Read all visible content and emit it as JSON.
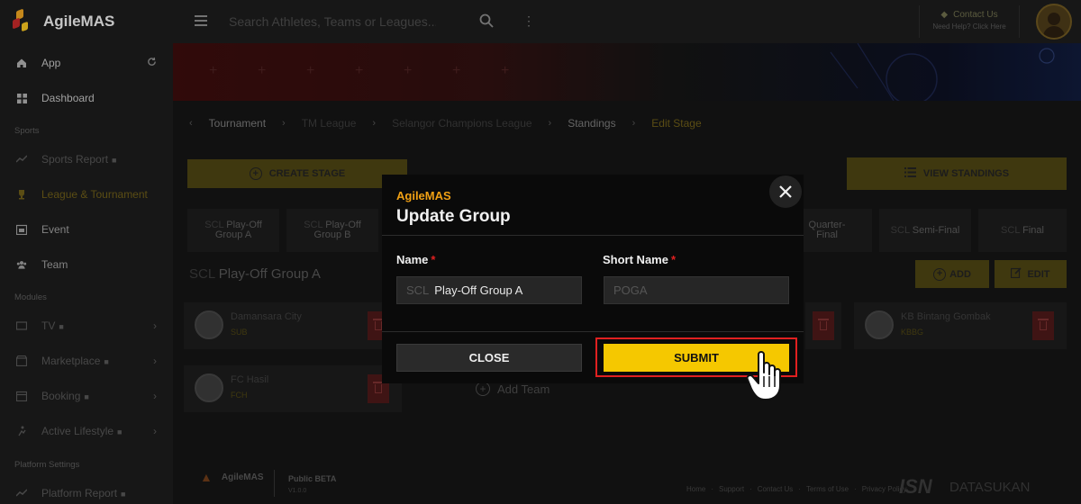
{
  "app": {
    "name": "AgileMAS"
  },
  "sidebar": {
    "items": [
      {
        "label": "App",
        "icon": "home-icon"
      },
      {
        "label": "Dashboard",
        "icon": "dashboard-icon"
      }
    ],
    "sections": {
      "sports": "Sports",
      "modules": "Modules",
      "platform": "Platform Settings"
    },
    "sports_items": [
      {
        "label": "Sports Report"
      },
      {
        "label": "League & Tournament"
      },
      {
        "label": "Event"
      },
      {
        "label": "Team"
      }
    ],
    "module_items": [
      {
        "label": "TV"
      },
      {
        "label": "Marketplace"
      },
      {
        "label": "Booking"
      },
      {
        "label": "Active Lifestyle"
      }
    ],
    "platform_items": [
      {
        "label": "Platform Report"
      }
    ]
  },
  "topbar": {
    "search_placeholder": "Search Athletes, Teams or Leagues...",
    "contact_title": "Contact Us",
    "contact_sub": "Need Help? Click Here"
  },
  "breadcrumb": {
    "tournament": "Tournament",
    "league": "TM League",
    "sub_league": "Selangor Champions League",
    "standings": "Standings",
    "current": "Edit Stage"
  },
  "toolbar": {
    "create_stage": "CREATE STAGE",
    "view_standings": "VIEW STANDINGS"
  },
  "tabs": [
    {
      "prefix": "SCL",
      "label": "Play-Off",
      "sub": "Group A"
    },
    {
      "prefix": "SCL",
      "label": "Play-Off",
      "sub": "Group B"
    },
    {
      "label": "Quarter-",
      "sub": "Final"
    },
    {
      "prefix": "SCL",
      "label": "Semi-Final"
    },
    {
      "prefix": "SCL",
      "label": "Final"
    }
  ],
  "group": {
    "prefix": "SCL",
    "title": "Play-Off Group A",
    "add_label": "ADD",
    "edit_label": "EDIT"
  },
  "teams": [
    {
      "name": "Damansara City",
      "sub": "SUB"
    },
    {
      "name": "KB Bintang Gombak",
      "sub": "KBBG"
    },
    {
      "name": "FC Hasil",
      "sub": "FCH"
    }
  ],
  "add_team": "Add Team",
  "footer": {
    "brand": "AgileMAS",
    "beta": "Public BETA",
    "version": "V1.0.0",
    "links": [
      "Home",
      "Support",
      "Contact Us",
      "Terms of Use",
      "Privacy Policy"
    ],
    "isn": "ISN",
    "datasukan": "DATASUKAN"
  },
  "modal": {
    "brand": "AgileMAS",
    "title": "Update Group",
    "name_label": "Name",
    "short_name_label": "Short Name",
    "required_mark": "*",
    "name_prefix": "SCL",
    "name_value": "Play-Off Group A",
    "short_name_value": "POGA",
    "close_label": "CLOSE",
    "submit_label": "SUBMIT"
  },
  "colors": {
    "accent": "#f5c800",
    "brand_orange": "#f0a014",
    "danger": "#e02020"
  }
}
